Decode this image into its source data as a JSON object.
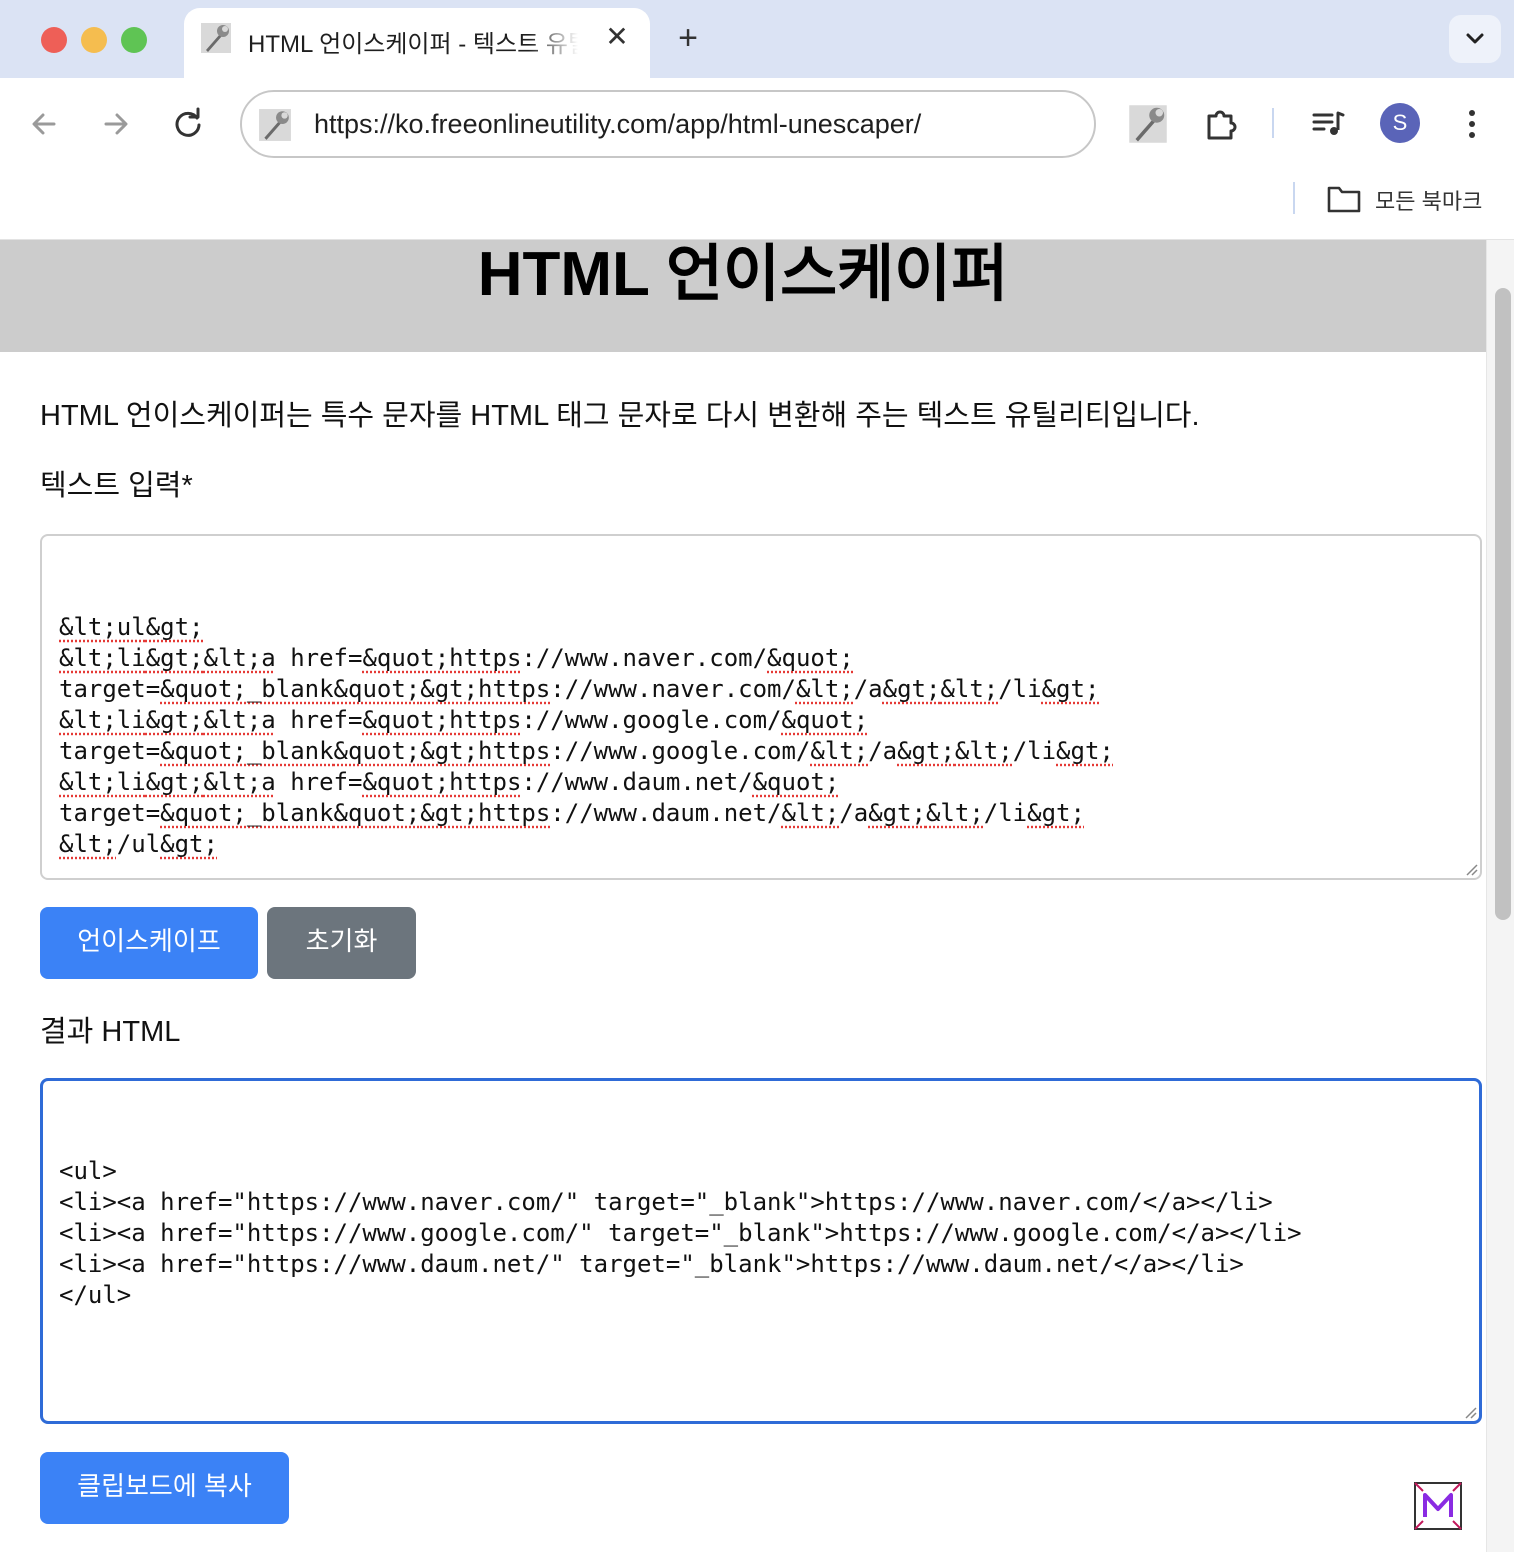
{
  "browser": {
    "tab_title": "HTML 언이스케이퍼 - 텍스트 유틸",
    "url": "https://ko.freeonlineutility.com/app/html-unescaper/",
    "profile_initial": "S",
    "bookmarks_label": "모든 북마크"
  },
  "page": {
    "title": "HTML 언이스케이퍼",
    "description": "HTML 언이스케이퍼는 특수 문자를 HTML 태그 문자로 다시 변환해 주는 텍스트 유틸리티입니다.",
    "input_label": "텍스트 입력*",
    "input_value": "&lt;ul&gt;\n&lt;li&gt;&lt;a href=&quot;https://www.naver.com/&quot;\ntarget=&quot;_blank&quot;&gt;https://www.naver.com/&lt;/a&gt;&lt;/li&gt;\n&lt;li&gt;&lt;a href=&quot;https://www.google.com/&quot;\ntarget=&quot;_blank&quot;&gt;https://www.google.com/&lt;/a&gt;&lt;/li&gt;\n&lt;li&gt;&lt;a href=&quot;https://www.daum.net/&quot;\ntarget=&quot;_blank&quot;&gt;https://www.daum.net/&lt;/a&gt;&lt;/li&gt;\n&lt;/ul&gt;",
    "unescape_button": "언이스케이프",
    "reset_button": "초기화",
    "result_label": "결과 HTML",
    "result_value": "<ul>\n<li><a href=\"https://www.naver.com/\" target=\"_blank\">https://www.naver.com/</a></li>\n<li><a href=\"https://www.google.com/\" target=\"_blank\">https://www.google.com/</a></li>\n<li><a href=\"https://www.daum.net/\" target=\"_blank\">https://www.daum.net/</a></li>\n</ul>",
    "copy_button": "클립보드에 복사"
  },
  "colors": {
    "primary_button": "#3b82f6",
    "secondary_button": "#6c757d",
    "header_band": "#cccccc",
    "focus_border": "#2f6bd7"
  },
  "icons": [
    "back-arrow-icon",
    "forward-arrow-icon",
    "reload-icon",
    "wrench-favicon-icon",
    "extensions-icon",
    "media-queue-icon",
    "more-menu-icon",
    "folder-icon",
    "tab-search-chevron-icon",
    "close-icon",
    "plus-icon"
  ]
}
